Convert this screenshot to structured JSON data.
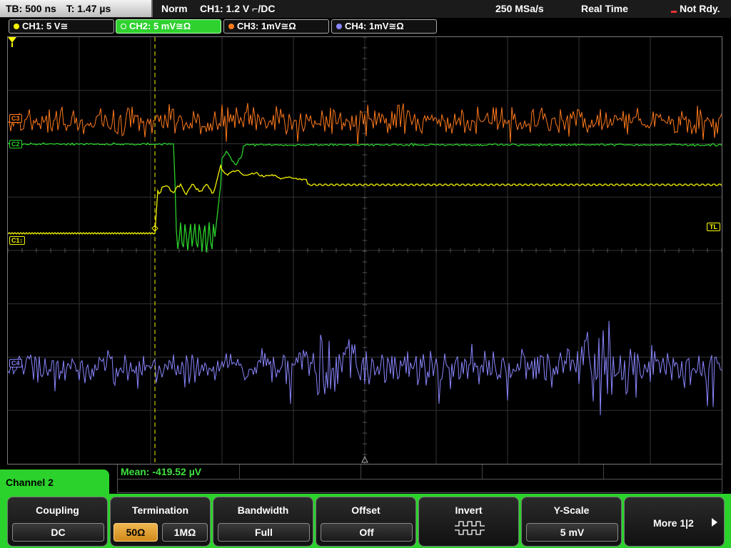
{
  "status": {
    "timebase": "TB: 500 ns",
    "trigger_time": "T: 1.47 µs",
    "trigger_mode": "Norm",
    "trigger_source": "CH1: 1.2 V ⌐/DC",
    "sample_rate": "250 MSa/s",
    "acq_mode": "Real Time",
    "ready_state": "Not Rdy."
  },
  "channels": [
    {
      "label": "CH1: 5 V≅",
      "color": "#f5f500"
    },
    {
      "label": "CH2: 5 mV≅Ω",
      "color": "#2fd12f"
    },
    {
      "label": "CH3: 1mV≅Ω",
      "color": "#ff7a1c"
    },
    {
      "label": "CH4: 1mV≅Ω",
      "color": "#8a86ff"
    }
  ],
  "markers": {
    "ch1_level": "C1↕",
    "ch2_level": "C2",
    "ch3_level": "C3",
    "ch4_level": "C4",
    "trigger_level": "TL"
  },
  "measurement": {
    "mean": "Mean: -419.52 µV"
  },
  "menu": {
    "channel_label": "Channel 2",
    "coupling": {
      "title": "Coupling",
      "value": "DC"
    },
    "termination": {
      "title": "Termination",
      "opt1": "50Ω",
      "opt2": "1MΩ"
    },
    "bandwidth": {
      "title": "Bandwidth",
      "value": "Full"
    },
    "offset": {
      "title": "Offset",
      "value": "Off"
    },
    "invert": {
      "title": "Invert",
      "icon": "invert-wave-icon"
    },
    "yscale": {
      "title": "Y-Scale",
      "value": "5 mV"
    },
    "more": {
      "label": "More 1|2",
      "icon": "triangle-right-icon"
    }
  },
  "colors": {
    "accent_green": "#2bd22b",
    "selected_orange": "#e8a030",
    "grid": "#3a3a3a"
  }
}
